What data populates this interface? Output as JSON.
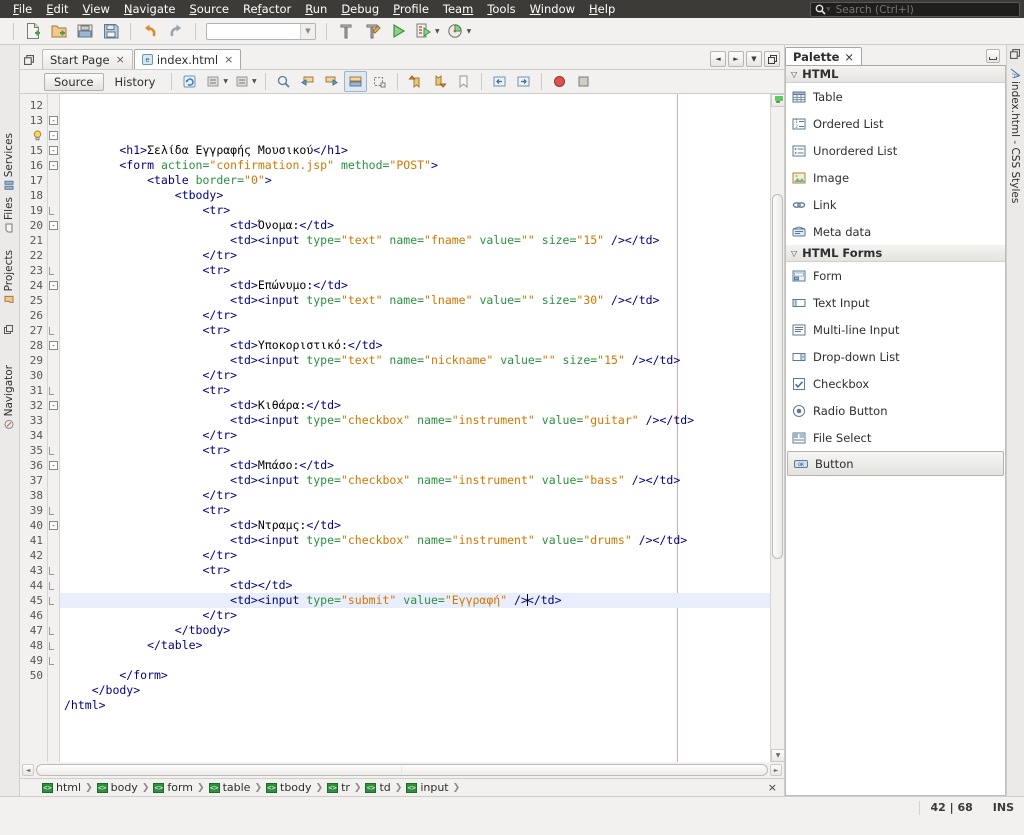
{
  "menu": {
    "items": [
      {
        "label": "File",
        "mnemonic": "F"
      },
      {
        "label": "Edit",
        "mnemonic": "E"
      },
      {
        "label": "View",
        "mnemonic": "V"
      },
      {
        "label": "Navigate",
        "mnemonic": "N"
      },
      {
        "label": "Source",
        "mnemonic": "S"
      },
      {
        "label": "Refactor",
        "mnemonic": "f"
      },
      {
        "label": "Run",
        "mnemonic": "R"
      },
      {
        "label": "Debug",
        "mnemonic": "D"
      },
      {
        "label": "Profile",
        "mnemonic": "P"
      },
      {
        "label": "Team",
        "mnemonic": "m"
      },
      {
        "label": "Tools",
        "mnemonic": "T"
      },
      {
        "label": "Window",
        "mnemonic": "W"
      },
      {
        "label": "Help",
        "mnemonic": "H"
      }
    ]
  },
  "search": {
    "placeholder": "Search (Ctrl+I)",
    "value": ""
  },
  "toolbar": {
    "buttons": [
      {
        "name": "new-file-icon",
        "tip": "New File"
      },
      {
        "name": "new-project-icon",
        "tip": "New Project"
      },
      {
        "name": "open-project-icon",
        "tip": "Open Project"
      },
      {
        "name": "save-all-icon",
        "tip": "Save All"
      },
      {
        "name": "undo-icon",
        "tip": "Undo"
      },
      {
        "name": "redo-icon",
        "tip": "Redo"
      },
      {
        "name": "build-project-icon",
        "tip": "Build Project"
      },
      {
        "name": "clean-build-icon",
        "tip": "Clean and Build Project"
      },
      {
        "name": "run-project-icon",
        "tip": "Run Project"
      },
      {
        "name": "debug-project-icon",
        "tip": "Debug Project"
      },
      {
        "name": "profile-project-icon",
        "tip": "Profile Project"
      }
    ],
    "config_combo_value": ""
  },
  "left_dock": {
    "tabs": [
      {
        "label": "Services",
        "icon": "services-icon"
      },
      {
        "label": "Files",
        "icon": "files-icon"
      },
      {
        "label": "Projects",
        "icon": "projects-icon"
      },
      {
        "label": "Navigator",
        "icon": "navigator-icon"
      }
    ]
  },
  "right_dock": {
    "tabs": [
      {
        "label": "index.html - CSS Styles",
        "icon": "css-styles-icon"
      }
    ]
  },
  "document_tabs": [
    {
      "label": "Start Page",
      "active": false,
      "closable": true,
      "icon": null
    },
    {
      "label": "index.html",
      "active": true,
      "closable": true,
      "icon": "html-file-icon"
    }
  ],
  "tab_nav": {
    "buttons": [
      {
        "name": "scroll-tabs-left-button",
        "glyph": "◄"
      },
      {
        "name": "scroll-tabs-right-button",
        "glyph": "►"
      },
      {
        "name": "tab-list-button",
        "glyph": "▼"
      },
      {
        "name": "maximize-window-button",
        "glyph": "❐"
      }
    ]
  },
  "editor_toolbar": {
    "source_label": "Source",
    "history_label": "History",
    "icons": [
      {
        "name": "refresh-icon"
      },
      {
        "name": "collapse-fold-icon"
      },
      {
        "name": "expand-fold-icon"
      },
      {
        "name": "find-selection-icon"
      },
      {
        "name": "previous-occurrence-icon"
      },
      {
        "name": "next-occurrence-icon"
      },
      {
        "name": "toggle-highlight-icon"
      },
      {
        "name": "toggle-rectangular-selection-icon"
      },
      {
        "name": "previous-bookmark-icon"
      },
      {
        "name": "next-bookmark-icon"
      },
      {
        "name": "toggle-bookmark-icon"
      },
      {
        "name": "shift-line-left-icon"
      },
      {
        "name": "shift-line-right-icon"
      },
      {
        "name": "start-macro-recording-icon"
      },
      {
        "name": "stop-macro-recording-icon"
      }
    ]
  },
  "code": {
    "first_line_number": 12,
    "current_line": 42,
    "hint_line": 14,
    "right_margin_column": 80,
    "lines": [
      {
        "n": 12,
        "fold": null,
        "tokens": [
          {
            "t": "tag",
            "v": "        <h1>"
          },
          {
            "t": "txt",
            "v": "Σελίδα Εγγραφής Μουσικού"
          },
          {
            "t": "tag",
            "v": "</h1>"
          }
        ]
      },
      {
        "n": 13,
        "fold": "start",
        "tokens": [
          {
            "t": "tag",
            "v": "        <form "
          },
          {
            "t": "attr",
            "v": "action="
          },
          {
            "t": "val",
            "v": "\"confirmation.jsp\""
          },
          {
            "t": "attr",
            "v": " method="
          },
          {
            "t": "val",
            "v": "\"POST\""
          },
          {
            "t": "tag",
            "v": ">"
          }
        ]
      },
      {
        "n": 14,
        "fold": "start",
        "hint": true,
        "tokens": [
          {
            "t": "tag",
            "v": "            <table "
          },
          {
            "t": "attr",
            "v": "border="
          },
          {
            "t": "val",
            "v": "\"0\""
          },
          {
            "t": "tag",
            "v": ">"
          }
        ]
      },
      {
        "n": 15,
        "fold": "start",
        "tokens": [
          {
            "t": "tag",
            "v": "                <tbody>"
          }
        ]
      },
      {
        "n": 16,
        "fold": "start",
        "tokens": [
          {
            "t": "tag",
            "v": "                    <tr>"
          }
        ]
      },
      {
        "n": 17,
        "fold": null,
        "tokens": [
          {
            "t": "tag",
            "v": "                        <td>"
          },
          {
            "t": "txt",
            "v": "Όνομα:"
          },
          {
            "t": "tag",
            "v": "</td>"
          }
        ]
      },
      {
        "n": 18,
        "fold": null,
        "tokens": [
          {
            "t": "tag",
            "v": "                        <td><input "
          },
          {
            "t": "attr",
            "v": "type="
          },
          {
            "t": "val",
            "v": "\"text\""
          },
          {
            "t": "attr",
            "v": " name="
          },
          {
            "t": "val",
            "v": "\"fname\""
          },
          {
            "t": "attr",
            "v": " value="
          },
          {
            "t": "val",
            "v": "\"\""
          },
          {
            "t": "attr",
            "v": " size="
          },
          {
            "t": "val",
            "v": "\"15\""
          },
          {
            "t": "tag",
            "v": " /></td>"
          }
        ]
      },
      {
        "n": 19,
        "fold": "end",
        "tokens": [
          {
            "t": "tag",
            "v": "                    </tr>"
          }
        ]
      },
      {
        "n": 20,
        "fold": "start",
        "tokens": [
          {
            "t": "tag",
            "v": "                    <tr>"
          }
        ]
      },
      {
        "n": 21,
        "fold": null,
        "tokens": [
          {
            "t": "tag",
            "v": "                        <td>"
          },
          {
            "t": "txt",
            "v": "Επώνυμο:"
          },
          {
            "t": "tag",
            "v": "</td>"
          }
        ]
      },
      {
        "n": 22,
        "fold": null,
        "tokens": [
          {
            "t": "tag",
            "v": "                        <td><input "
          },
          {
            "t": "attr",
            "v": "type="
          },
          {
            "t": "val",
            "v": "\"text\""
          },
          {
            "t": "attr",
            "v": " name="
          },
          {
            "t": "val",
            "v": "\"lname\""
          },
          {
            "t": "attr",
            "v": " value="
          },
          {
            "t": "val",
            "v": "\"\""
          },
          {
            "t": "attr",
            "v": " size="
          },
          {
            "t": "val",
            "v": "\"30\""
          },
          {
            "t": "tag",
            "v": " /></td>"
          }
        ]
      },
      {
        "n": 23,
        "fold": "end",
        "tokens": [
          {
            "t": "tag",
            "v": "                    </tr>"
          }
        ]
      },
      {
        "n": 24,
        "fold": "start",
        "tokens": [
          {
            "t": "tag",
            "v": "                    <tr>"
          }
        ]
      },
      {
        "n": 25,
        "fold": null,
        "tokens": [
          {
            "t": "tag",
            "v": "                        <td>"
          },
          {
            "t": "txt",
            "v": "Υποκοριστικό:"
          },
          {
            "t": "tag",
            "v": "</td>"
          }
        ]
      },
      {
        "n": 26,
        "fold": null,
        "tokens": [
          {
            "t": "tag",
            "v": "                        <td><input "
          },
          {
            "t": "attr",
            "v": "type="
          },
          {
            "t": "val",
            "v": "\"text\""
          },
          {
            "t": "attr",
            "v": " name="
          },
          {
            "t": "val",
            "v": "\"nickname\""
          },
          {
            "t": "attr",
            "v": " value="
          },
          {
            "t": "val",
            "v": "\"\""
          },
          {
            "t": "attr",
            "v": " size="
          },
          {
            "t": "val",
            "v": "\"15\""
          },
          {
            "t": "tag",
            "v": " /></td>"
          }
        ]
      },
      {
        "n": 27,
        "fold": "end",
        "tokens": [
          {
            "t": "tag",
            "v": "                    </tr>"
          }
        ]
      },
      {
        "n": 28,
        "fold": "start",
        "tokens": [
          {
            "t": "tag",
            "v": "                    <tr>"
          }
        ]
      },
      {
        "n": 29,
        "fold": null,
        "tokens": [
          {
            "t": "tag",
            "v": "                        <td>"
          },
          {
            "t": "txt",
            "v": "Κιθάρα:"
          },
          {
            "t": "tag",
            "v": "</td>"
          }
        ]
      },
      {
        "n": 30,
        "fold": null,
        "tokens": [
          {
            "t": "tag",
            "v": "                        <td><input "
          },
          {
            "t": "attr",
            "v": "type="
          },
          {
            "t": "val",
            "v": "\"checkbox\""
          },
          {
            "t": "attr",
            "v": " name="
          },
          {
            "t": "val",
            "v": "\"instrument\""
          },
          {
            "t": "attr",
            "v": " value="
          },
          {
            "t": "val",
            "v": "\"guitar\""
          },
          {
            "t": "tag",
            "v": " /></td>"
          }
        ]
      },
      {
        "n": 31,
        "fold": "end",
        "tokens": [
          {
            "t": "tag",
            "v": "                    </tr>"
          }
        ]
      },
      {
        "n": 32,
        "fold": "start",
        "tokens": [
          {
            "t": "tag",
            "v": "                    <tr>"
          }
        ]
      },
      {
        "n": 33,
        "fold": null,
        "tokens": [
          {
            "t": "tag",
            "v": "                        <td>"
          },
          {
            "t": "txt",
            "v": "Μπάσο:"
          },
          {
            "t": "tag",
            "v": "</td>"
          }
        ]
      },
      {
        "n": 34,
        "fold": null,
        "tokens": [
          {
            "t": "tag",
            "v": "                        <td><input "
          },
          {
            "t": "attr",
            "v": "type="
          },
          {
            "t": "val",
            "v": "\"checkbox\""
          },
          {
            "t": "attr",
            "v": " name="
          },
          {
            "t": "val",
            "v": "\"instrument\""
          },
          {
            "t": "attr",
            "v": " value="
          },
          {
            "t": "val",
            "v": "\"bass\""
          },
          {
            "t": "tag",
            "v": " /></td>"
          }
        ]
      },
      {
        "n": 35,
        "fold": "end",
        "tokens": [
          {
            "t": "tag",
            "v": "                    </tr>"
          }
        ]
      },
      {
        "n": 36,
        "fold": "start",
        "tokens": [
          {
            "t": "tag",
            "v": "                    <tr>"
          }
        ]
      },
      {
        "n": 37,
        "fold": null,
        "tokens": [
          {
            "t": "tag",
            "v": "                        <td>"
          },
          {
            "t": "txt",
            "v": "Ντραμς:"
          },
          {
            "t": "tag",
            "v": "</td>"
          }
        ]
      },
      {
        "n": 38,
        "fold": null,
        "tokens": [
          {
            "t": "tag",
            "v": "                        <td><input "
          },
          {
            "t": "attr",
            "v": "type="
          },
          {
            "t": "val",
            "v": "\"checkbox\""
          },
          {
            "t": "attr",
            "v": " name="
          },
          {
            "t": "val",
            "v": "\"instrument\""
          },
          {
            "t": "attr",
            "v": " value="
          },
          {
            "t": "val",
            "v": "\"drums\""
          },
          {
            "t": "tag",
            "v": " /></td>"
          }
        ]
      },
      {
        "n": 39,
        "fold": "end",
        "tokens": [
          {
            "t": "tag",
            "v": "                    </tr>"
          }
        ]
      },
      {
        "n": 40,
        "fold": "start",
        "tokens": [
          {
            "t": "tag",
            "v": "                    <tr>"
          }
        ]
      },
      {
        "n": 41,
        "fold": null,
        "tokens": [
          {
            "t": "tag",
            "v": "                        <td></td>"
          }
        ]
      },
      {
        "n": 42,
        "fold": null,
        "current": true,
        "tokens": [
          {
            "t": "tag",
            "v": "                        <td><input "
          },
          {
            "t": "attr",
            "v": "type="
          },
          {
            "t": "val",
            "v": "\"submit\""
          },
          {
            "t": "attr",
            "v": " value="
          },
          {
            "t": "val",
            "v": "\"Εγγραφή\""
          },
          {
            "t": "tag",
            "v": " />"
          },
          {
            "t": "caret",
            "v": ""
          },
          {
            "t": "tag",
            "v": "</td>"
          }
        ]
      },
      {
        "n": 43,
        "fold": "end",
        "tokens": [
          {
            "t": "tag",
            "v": "                    </tr>"
          }
        ]
      },
      {
        "n": 44,
        "fold": "end",
        "tokens": [
          {
            "t": "tag",
            "v": "                </tbody>"
          }
        ]
      },
      {
        "n": 45,
        "fold": "end",
        "tokens": [
          {
            "t": "tag",
            "v": "            </table>"
          }
        ]
      },
      {
        "n": 46,
        "fold": null,
        "tokens": [
          {
            "t": "txt",
            "v": ""
          }
        ]
      },
      {
        "n": 47,
        "fold": "end",
        "tokens": [
          {
            "t": "tag",
            "v": "        </form>"
          }
        ]
      },
      {
        "n": 48,
        "fold": "end",
        "tokens": [
          {
            "t": "tag",
            "v": "    </body>"
          }
        ]
      },
      {
        "n": 49,
        "fold": "end",
        "tokens": [
          {
            "t": "tag",
            "v": "/html>"
          }
        ]
      },
      {
        "n": 50,
        "fold": null,
        "tokens": [
          {
            "t": "txt",
            "v": ""
          }
        ]
      }
    ]
  },
  "breadcrumb": {
    "items": [
      "html",
      "body",
      "form",
      "table",
      "tbody",
      "tr",
      "td",
      "input"
    ],
    "close_label": "×"
  },
  "palette": {
    "title": "Palette",
    "close_label": "×",
    "categories": [
      {
        "name": "HTML",
        "expanded": true,
        "items": [
          {
            "label": "Table",
            "icon": "table-icon"
          },
          {
            "label": "Ordered List",
            "icon": "ordered-list-icon"
          },
          {
            "label": "Unordered List",
            "icon": "unordered-list-icon"
          },
          {
            "label": "Image",
            "icon": "image-icon"
          },
          {
            "label": "Link",
            "icon": "link-icon"
          },
          {
            "label": "Meta data",
            "icon": "meta-data-icon"
          }
        ]
      },
      {
        "name": "HTML Forms",
        "expanded": true,
        "items": [
          {
            "label": "Form",
            "icon": "form-icon"
          },
          {
            "label": "Text Input",
            "icon": "text-input-icon"
          },
          {
            "label": "Multi-line Input",
            "icon": "multi-line-input-icon"
          },
          {
            "label": "Drop-down List",
            "icon": "drop-down-list-icon"
          },
          {
            "label": "Checkbox",
            "icon": "checkbox-icon"
          },
          {
            "label": "Radio Button",
            "icon": "radio-button-icon"
          },
          {
            "label": "File Select",
            "icon": "file-select-icon"
          },
          {
            "label": "Button",
            "icon": "button-icon",
            "selected": true
          }
        ]
      }
    ]
  },
  "status_bar": {
    "caret_position": "42 | 68",
    "insert_mode": "INS"
  },
  "colors": {
    "tag": "#000080",
    "attribute": "#2b9040",
    "value": "#d47500",
    "current_line_bg": "#e8eefb",
    "right_margin": "#f0a0a0",
    "annotation_mark": "#5ecb5e"
  }
}
